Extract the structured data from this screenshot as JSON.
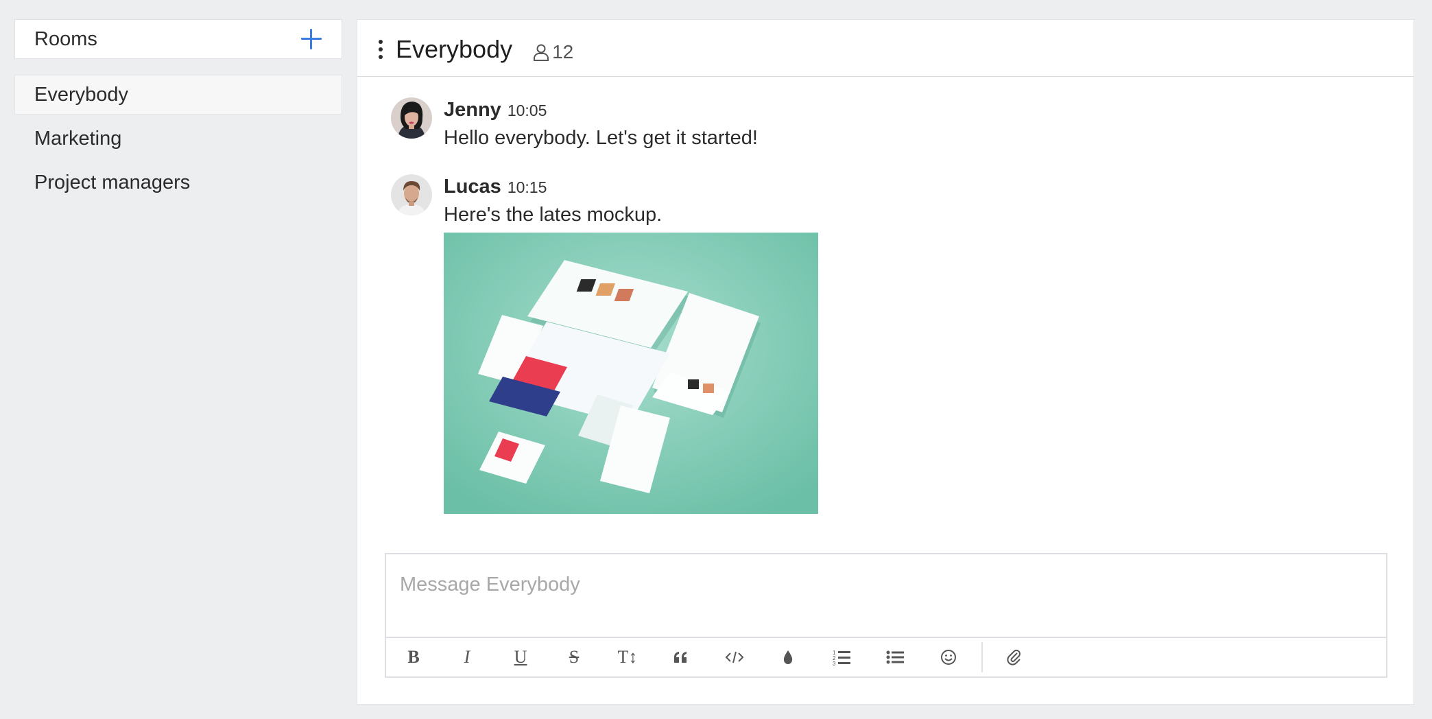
{
  "sidebar": {
    "title": "Rooms",
    "add_icon": "plus-icon",
    "rooms": [
      {
        "label": "Everybody",
        "active": true
      },
      {
        "label": "Marketing",
        "active": false
      },
      {
        "label": "Project managers",
        "active": false
      }
    ]
  },
  "room": {
    "name": "Everybody",
    "member_count": "12",
    "menu_icon": "kebab-menu-icon",
    "members_icon": "user-icon"
  },
  "messages": [
    {
      "author": "Jenny",
      "time": "10:05",
      "text": "Hello everybody. Let's get it started!",
      "avatar_icon": "avatar-jenny"
    },
    {
      "author": "Lucas",
      "time": "10:15",
      "text": "Here's the lates mockup.",
      "avatar_icon": "avatar-lucas",
      "attachment": "mockup-image"
    }
  ],
  "composer": {
    "placeholder": "Message Everybody",
    "tools": [
      "bold",
      "italic",
      "underline",
      "strikethrough",
      "text-size",
      "quote",
      "code",
      "color",
      "ordered-list",
      "bullet-list",
      "emoji",
      "attach"
    ]
  },
  "colors": {
    "accent": "#3a7de0",
    "background": "#edeef0",
    "image_teal": "#7ecab4"
  }
}
